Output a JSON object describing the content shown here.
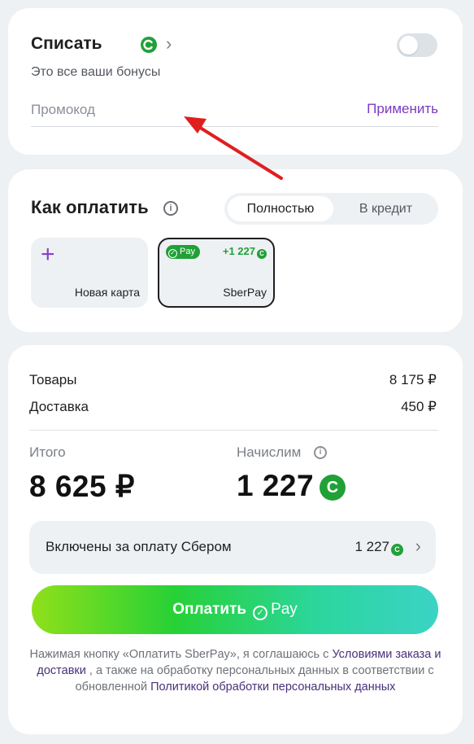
{
  "bonus": {
    "title": "Списать",
    "badge_icon": "sber-bonus-icon",
    "subtitle": "Это все ваши бонусы",
    "promo_placeholder": "Промокод",
    "apply_label": "Применить",
    "toggle_on": false
  },
  "payment": {
    "title": "Как оплатить",
    "segments": [
      "Полностью",
      "В кредит"
    ],
    "selected_segment": "Полностью",
    "new_card_label": "Новая карта",
    "sberpay_pill": "Pay",
    "sberpay_bonus": "+1 227",
    "sberpay_label": "SberPay"
  },
  "summary": {
    "goods_label": "Товары",
    "goods_value": "8 175 ₽",
    "delivery_label": "Доставка",
    "delivery_value": "450 ₽",
    "total_label": "Итого",
    "total_value": "8 625 ₽",
    "accrue_label": "Начислим",
    "accrue_value": "1 227",
    "included_label": "Включены за оплату Сбером",
    "included_value": "1 227",
    "pay_button": "Оплатить",
    "pay_button_suffix": "Pay",
    "legal_1": "Нажимая кнопку «Оплатить SberPay», я соглашаюсь с ",
    "legal_link_1": "Условиями заказа и доставки",
    "legal_2": " , а также на обработку персональных данных в соответствии с обновленной ",
    "legal_link_2": "Политикой обработки персональных данных"
  },
  "colors": {
    "accent_purple": "#7b3ac1",
    "sber_green": "#21a038",
    "annotation_red": "#e01e1e"
  }
}
